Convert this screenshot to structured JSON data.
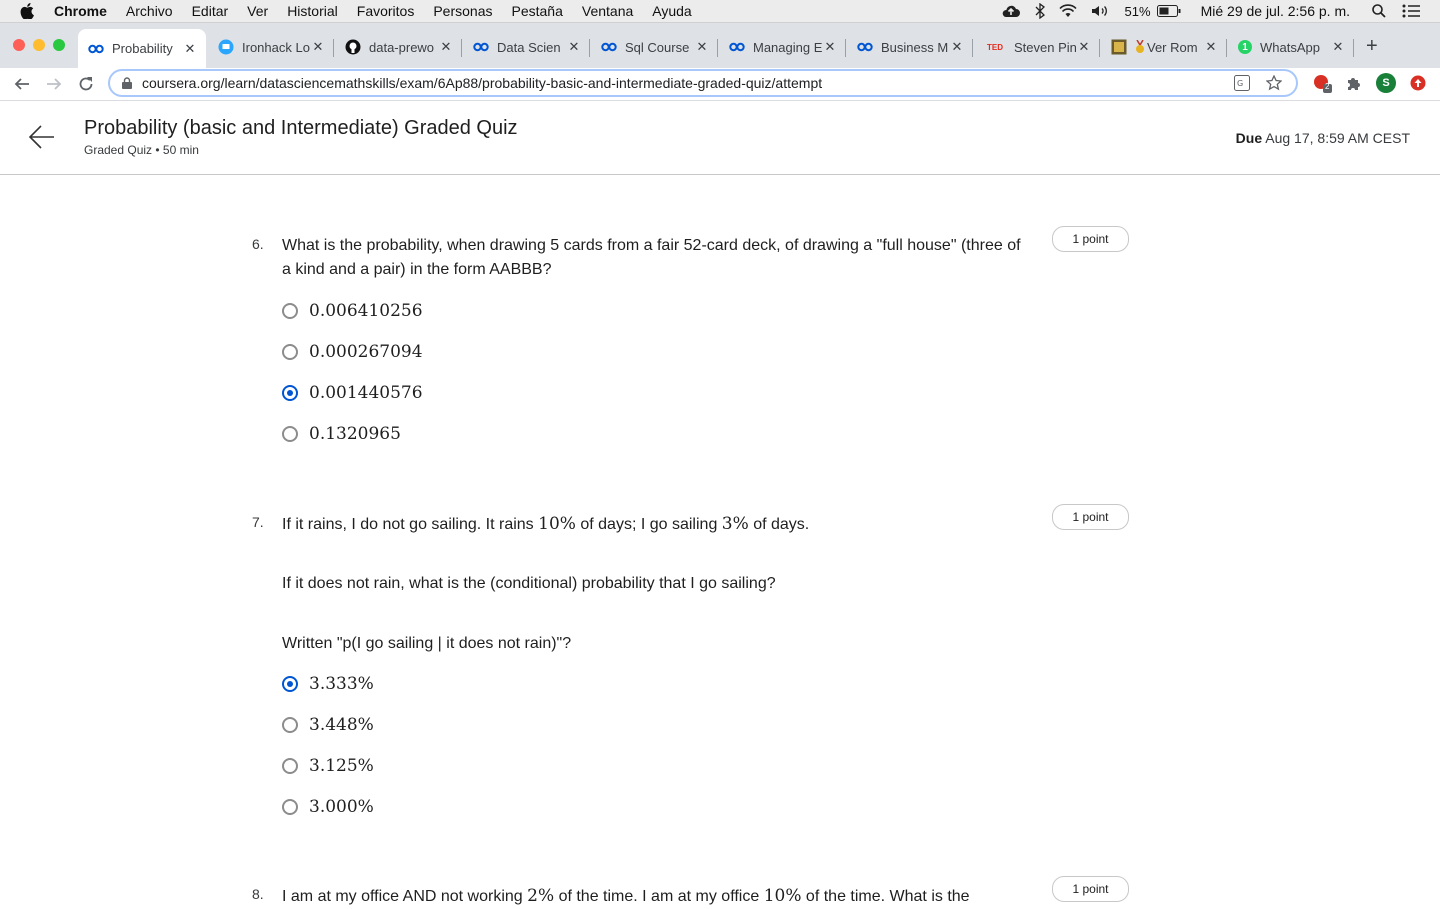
{
  "menubar": {
    "app_name": "Chrome",
    "items": [
      "Archivo",
      "Editar",
      "Ver",
      "Historial",
      "Favoritos",
      "Personas",
      "Pestaña",
      "Ventana",
      "Ayuda"
    ],
    "battery": "51%",
    "datetime": "Mié 29 de jul.  2:56 p. m."
  },
  "tabs": [
    {
      "label": "Probability",
      "icon": "coursera-icon"
    },
    {
      "label": "Ironhack Lo",
      "icon": "ironhack-icon"
    },
    {
      "label": "data-prewo",
      "icon": "github-icon"
    },
    {
      "label": "Data Scien",
      "icon": "coursera-icon"
    },
    {
      "label": "Sql Course",
      "icon": "coursera-icon"
    },
    {
      "label": "Managing E",
      "icon": "coursera-icon"
    },
    {
      "label": "Business M",
      "icon": "coursera-icon"
    },
    {
      "label": "Steven Pin",
      "icon": "ted-icon",
      "icon_text": "TED"
    },
    {
      "label": "Ver Rom",
      "icon": "medal-icon"
    },
    {
      "label": "WhatsApp",
      "icon": "whatsapp-icon",
      "icon_text": "1"
    }
  ],
  "address_bar": {
    "domain": "coursera.org",
    "path": "/learn/datasciencemathskills/exam/6Ap88/probability-basic-and-intermediate-graded-quiz/attempt"
  },
  "extensions": {
    "badge_count": "2",
    "profile_initial": "S"
  },
  "header": {
    "title": "Probability (basic and Intermediate) Graded Quiz",
    "subtitle": "Graded Quiz • 50 min",
    "due_label": "Due",
    "due_value": "Aug 17, 8:59 AM CEST"
  },
  "questions": [
    {
      "number": "6.",
      "text": "What is the probability, when drawing 5 cards from a fair 52-card deck, of drawing a \"full house\" (three of a kind and a pair) in the form AABBB?",
      "points": "1 point",
      "options": [
        "0.006410256",
        "0.000267094",
        "0.001440576",
        "0.1320965"
      ],
      "selected_index": 2
    },
    {
      "number": "7.",
      "text_a": "If it rains, I do not go sailing. It rains ",
      "text_b": "10%",
      "text_c": " of days; I go sailing ",
      "text_d": "3%",
      "text_e": " of days.",
      "para2": "If it does not rain, what is the (conditional) probability that I go sailing?",
      "para3": "Written \"p(I go sailing | it does not rain)\"?",
      "points": "1 point",
      "options": [
        "3.333%",
        "3.448%",
        "3.125%",
        "3.000%"
      ],
      "selected_index": 0
    },
    {
      "number": "8.",
      "text_a": "I am at my office AND not working ",
      "text_b": "2%",
      "text_c": " of the time. I am at my office ",
      "text_d": "10%",
      "text_e": " of the time. What is the",
      "points": "1 point"
    }
  ],
  "colors": {
    "accent": "#0056d2",
    "tab_strip": "#dee1e6",
    "border": "#c8c8c8"
  }
}
